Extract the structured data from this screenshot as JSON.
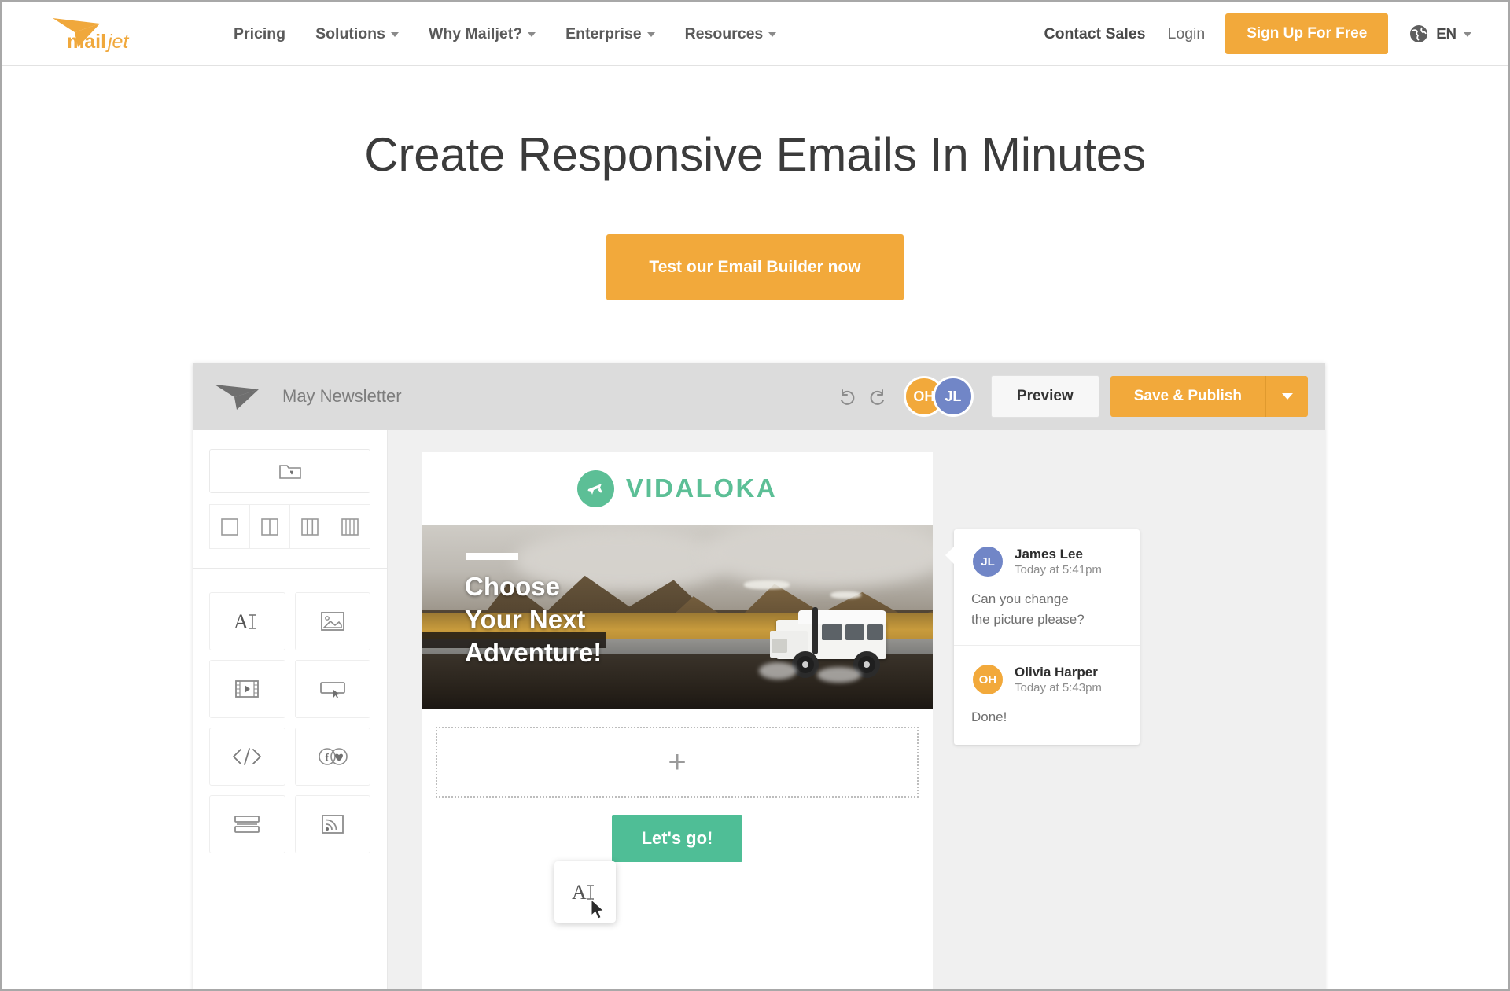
{
  "site": {
    "logo_text": "mailjet"
  },
  "nav": {
    "links": [
      {
        "label": "Pricing",
        "has_caret": false
      },
      {
        "label": "Solutions",
        "has_caret": true
      },
      {
        "label": "Why Mailjet?",
        "has_caret": true
      },
      {
        "label": "Enterprise",
        "has_caret": true
      },
      {
        "label": "Resources",
        "has_caret": true
      }
    ],
    "contact_sales": "Contact Sales",
    "login": "Login",
    "signup": "Sign Up For Free",
    "language": "EN"
  },
  "hero": {
    "title": "Create Responsive Emails In Minutes",
    "cta": "Test our Email Builder now"
  },
  "builder": {
    "doc_title": "May Newsletter",
    "preview": "Preview",
    "publish": "Save & Publish",
    "avatars": [
      {
        "initials": "OH",
        "color": "#F2A93B"
      },
      {
        "initials": "JL",
        "color": "#7186C7"
      }
    ],
    "sidebar": {
      "saved_blocks_icon": "folder-heart-icon",
      "layouts": [
        {
          "name": "layout-1-column",
          "columns": 1
        },
        {
          "name": "layout-2-columns",
          "columns": 2
        },
        {
          "name": "layout-3-columns",
          "columns": 3
        },
        {
          "name": "layout-4-columns",
          "columns": 4
        }
      ],
      "tools": [
        {
          "name": "text-tool",
          "icon": "text-icon"
        },
        {
          "name": "image-tool",
          "icon": "image-icon"
        },
        {
          "name": "video-tool",
          "icon": "video-icon"
        },
        {
          "name": "button-tool",
          "icon": "button-icon"
        },
        {
          "name": "html-tool",
          "icon": "code-icon"
        },
        {
          "name": "social-tool",
          "icon": "social-icon"
        },
        {
          "name": "divider-tool",
          "icon": "divider-icon"
        },
        {
          "name": "rss-tool",
          "icon": "rss-icon"
        }
      ]
    },
    "email": {
      "brand": "VIDALOKA",
      "brand_color": "#5CBF96",
      "hero_headline_lines": [
        "Choose",
        "Your Next",
        "Adventure!"
      ],
      "drop_placeholder": "+",
      "cta": "Let's go!",
      "cta_color": "#4FBE96"
    },
    "comments": [
      {
        "initials": "JL",
        "name": "James Lee",
        "time": "Today at 5:41pm",
        "lines": [
          "Can you change",
          "the picture please?"
        ],
        "color": "#7186C7"
      },
      {
        "initials": "OH",
        "name": "Olivia Harper",
        "time": "Today at 5:43pm",
        "lines": [
          "Done!"
        ],
        "color": "#F2A93B"
      }
    ],
    "drag_tile_icon": "text-icon"
  },
  "colors": {
    "brand_orange": "#F2A93B",
    "accent_green": "#5CBF96"
  }
}
